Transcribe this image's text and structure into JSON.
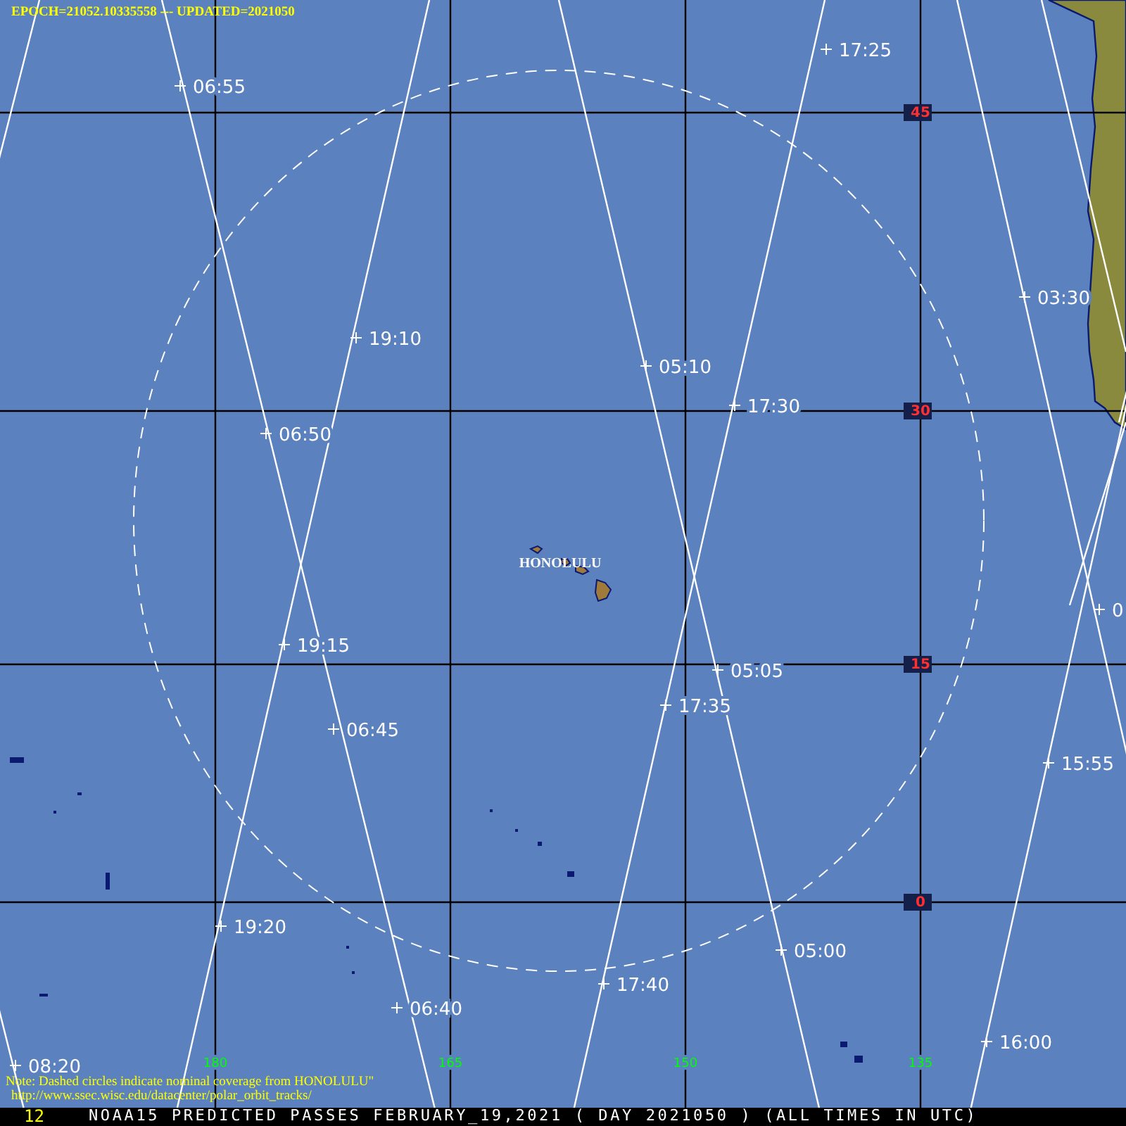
{
  "header": "EPOCH=21052.10335558 --- UPDATED=2021050",
  "pass_times": [
    "06:55",
    "17:25",
    "03:30",
    "19:10",
    "05:10",
    "17:30",
    "06:50",
    "19:15",
    "05:05",
    "17:35",
    "06:45",
    "15:55",
    "19:20",
    "05:00",
    "17:40",
    "06:40",
    "08:20",
    "16:00",
    "0"
  ],
  "latitudes": [
    "45",
    "30",
    "15",
    "0"
  ],
  "longitudes": [
    "180",
    "165",
    "150",
    "135"
  ],
  "station": "HONOLULU",
  "note": "Note: Dashed circles indicate nominal coverage from HONOLULU\"",
  "url": "http://www.ssec.wisc.edu/datacenter/polar_orbit_tracks/",
  "footer": {
    "frame": "12",
    "title": "NOAA15 PREDICTED PASSES FEBRUARY_19,2021 ( DAY 2021050 ) (ALL TIMES IN UTC)"
  }
}
